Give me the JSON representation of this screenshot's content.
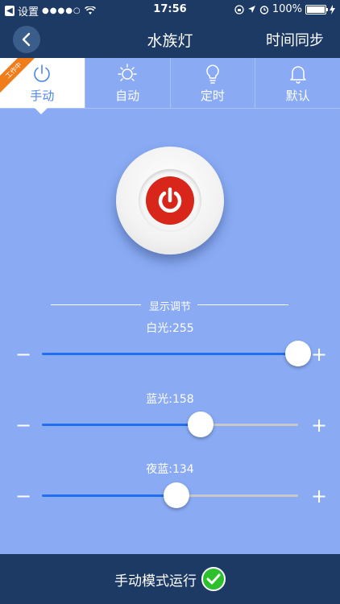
{
  "status_bar": {
    "carrier": "设置",
    "signal_dots": "●●●●○",
    "time": "17:56",
    "battery_text": "100%"
  },
  "nav": {
    "title": "水族灯",
    "right_action": "时间同步"
  },
  "tabs": [
    {
      "label": "手动",
      "icon": "power-icon",
      "active": true,
      "badge": "工作中"
    },
    {
      "label": "自动",
      "icon": "sun-icon",
      "active": false
    },
    {
      "label": "定时",
      "icon": "bulb-icon",
      "active": false
    },
    {
      "label": "默认",
      "icon": "bell-icon",
      "active": false
    }
  ],
  "section_title": "显示调节",
  "sliders": [
    {
      "label": "白光:255",
      "value": 255,
      "max": 255
    },
    {
      "label": "蓝光:158",
      "value": 158,
      "max": 255
    },
    {
      "label": "夜蓝:134",
      "value": 134,
      "max": 255
    }
  ],
  "minus_label": "−",
  "plus_label": "+",
  "bottom": {
    "status_text": "手动模式运行"
  },
  "colors": {
    "background": "#8aabf4",
    "navbar": "#1d3a64",
    "accent": "#4e86e8",
    "power": "#d8261b",
    "ribbon": "#f07c1a",
    "check": "#2cc12c"
  }
}
